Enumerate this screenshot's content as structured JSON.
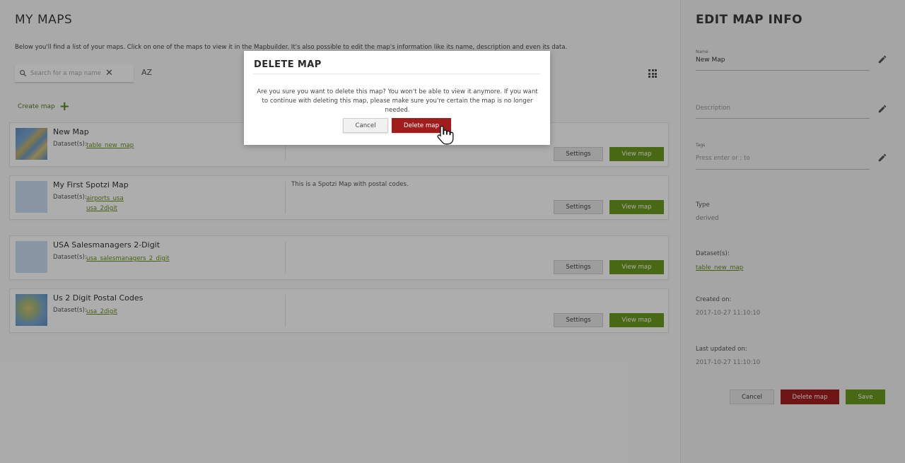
{
  "left": {
    "title": "MY MAPS",
    "intro": "Below you'll find a list of your maps. Click on one of the maps to view it in the Mapbuilder. It's also possible to edit the map's information like its name, description and even its data.",
    "search": {
      "placeholder": "Search for a map name or tag",
      "icon": "search-icon",
      "clear_icon": "close-icon"
    },
    "sort_label": "AZ",
    "create_map_label": "Create map",
    "dataset_label": "Dataset(s):",
    "settings_label": "Settings",
    "view_label": "View map",
    "maps": [
      {
        "name": "New Map",
        "datasets": [
          "table_new_map"
        ],
        "description": ""
      },
      {
        "name": "My First Spotzi Map",
        "datasets": [
          "airports_usa",
          "usa_2digit"
        ],
        "description": "This is a Spotzi Map with postal codes."
      },
      {
        "name": "USA Salesmanagers 2-Digit",
        "datasets": [
          "usa_salesmanagers_2_digit"
        ],
        "description": ""
      },
      {
        "name": "Us 2 Digit Postal Codes",
        "datasets": [
          "usa_2digit"
        ],
        "description": ""
      }
    ]
  },
  "right": {
    "title": "EDIT MAP INFO",
    "name_label": "Name",
    "name_value": "New Map",
    "description_placeholder": "Description",
    "tags_label": "Tags",
    "tags_placeholder": "Press enter or ; to",
    "type_label": "Type",
    "type_value": "derived",
    "datasets_label": "Dataset(s):",
    "datasets_value": "table_new_map",
    "created_label": "Created on:",
    "created_value": "2017-10-27 11:10:10",
    "updated_label": "Last updated on:",
    "updated_value": "2017-10-27 11:10:10",
    "cancel_label": "Cancel",
    "delete_label": "Delete map",
    "save_label": "Save"
  },
  "modal": {
    "title": "DELETE MAP",
    "message": "Are you sure you want to delete this map? You won't be able to view it anymore. If you want to continue with deleting this map, please make sure you're certain the map is no longer needed.",
    "cancel_label": "Cancel",
    "delete_label": "Delete map"
  },
  "colors": {
    "accent_green": "#6b9a1c",
    "danger_red": "#a01d1d"
  }
}
